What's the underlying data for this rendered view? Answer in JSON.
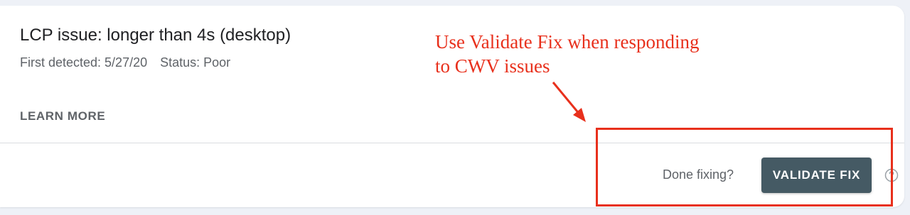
{
  "issue": {
    "title": "LCP issue: longer than 4s (desktop)",
    "first_detected": "First detected: 5/27/20",
    "status": "Status: Poor",
    "learn_more": "LEARN MORE"
  },
  "footer": {
    "done_prompt": "Done fixing?",
    "validate_label": "VALIDATE FIX",
    "help_icon": "help-circle-icon"
  },
  "annotation": {
    "line1": "Use Validate Fix when responding",
    "line2": "to CWV issues",
    "color": "#e8301c"
  },
  "colors": {
    "button_bg": "#455a64",
    "page_bg": "#eef1f7"
  }
}
